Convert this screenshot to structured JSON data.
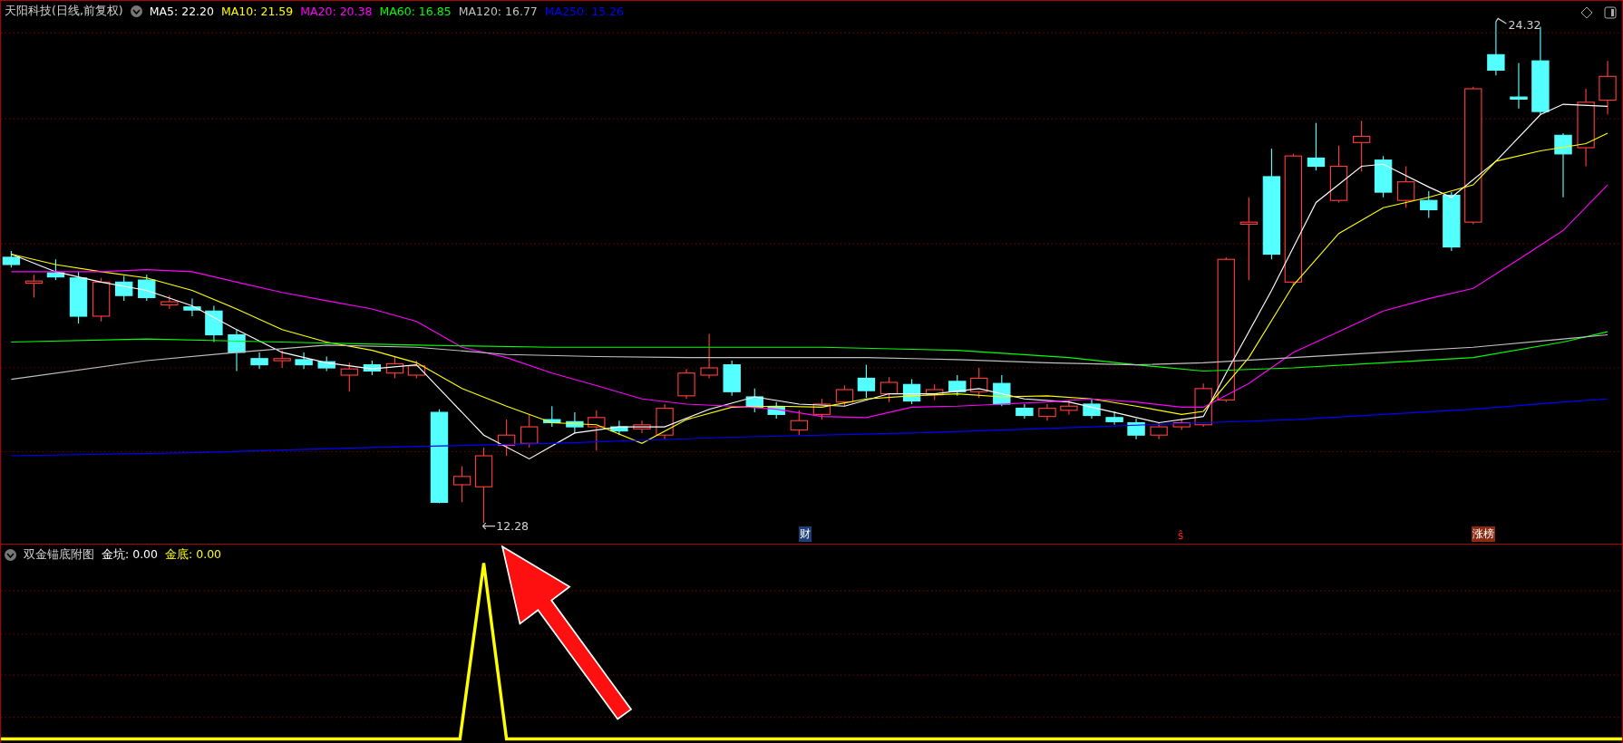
{
  "main_pane": {
    "title": "天阳科技(日线,前复权)",
    "indicators": [
      {
        "label": "MA5: 22.20",
        "color": "#ffffff"
      },
      {
        "label": "MA10: 21.59",
        "color": "#ffff00"
      },
      {
        "label": "MA20: 20.38",
        "color": "#ff00ff"
      },
      {
        "label": "MA60: 16.85",
        "color": "#00ff00"
      },
      {
        "label": "MA120: 16.77",
        "color": "#c0c0c0"
      },
      {
        "label": "MA250: 15.26",
        "color": "#0000ff"
      }
    ],
    "high_label": "24.32",
    "low_label": "12.28",
    "markers": [
      {
        "label": "财",
        "color": "#1c3f7a"
      },
      {
        "label": "ŝ",
        "color": "#000000"
      },
      {
        "label": "涨榜",
        "color": "#8a2a10"
      }
    ]
  },
  "sub_pane": {
    "title": "双金锚底附图",
    "indicators": [
      {
        "label": "金坑: 0.00",
        "color": "#ffffff"
      },
      {
        "label": "金底: 0.00",
        "color": "#ffff00"
      }
    ]
  }
}
